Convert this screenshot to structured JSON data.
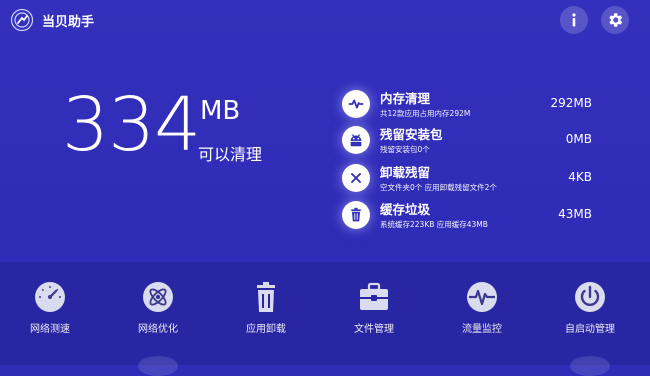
{
  "app": {
    "title": "当贝助手"
  },
  "header": {
    "info_icon": "info-icon",
    "settings_icon": "gear-icon"
  },
  "summary": {
    "amount": "334",
    "unit": "MB",
    "label": "可以清理"
  },
  "items": [
    {
      "icon": "pulse-icon",
      "title": "内存清理",
      "sub": "共12款应用占用内存292M",
      "value": "292MB"
    },
    {
      "icon": "android-icon",
      "title": "残留安装包",
      "sub": "残留安装包0个",
      "value": "0MB"
    },
    {
      "icon": "close-icon",
      "title": "卸载残留",
      "sub": "空文件夹0个 应用卸载残留文件2个",
      "value": "4KB"
    },
    {
      "icon": "trash-icon",
      "title": "缓存垃圾",
      "sub": "系统缓存223KB  应用缓存43MB",
      "value": "43MB"
    }
  ],
  "tools": [
    {
      "icon": "speedometer-icon",
      "label": "网络测速"
    },
    {
      "icon": "atom-icon",
      "label": "网络优化"
    },
    {
      "icon": "trash-icon",
      "label": "应用卸载"
    },
    {
      "icon": "briefcase-icon",
      "label": "文件管理"
    },
    {
      "icon": "pulse-icon",
      "label": "流量监控"
    },
    {
      "icon": "power-icon",
      "label": "自启动管理"
    }
  ],
  "colors": {
    "background": "#2f2cb8",
    "toolbar": "#2926a4",
    "icon_fg": "#3330b8"
  }
}
